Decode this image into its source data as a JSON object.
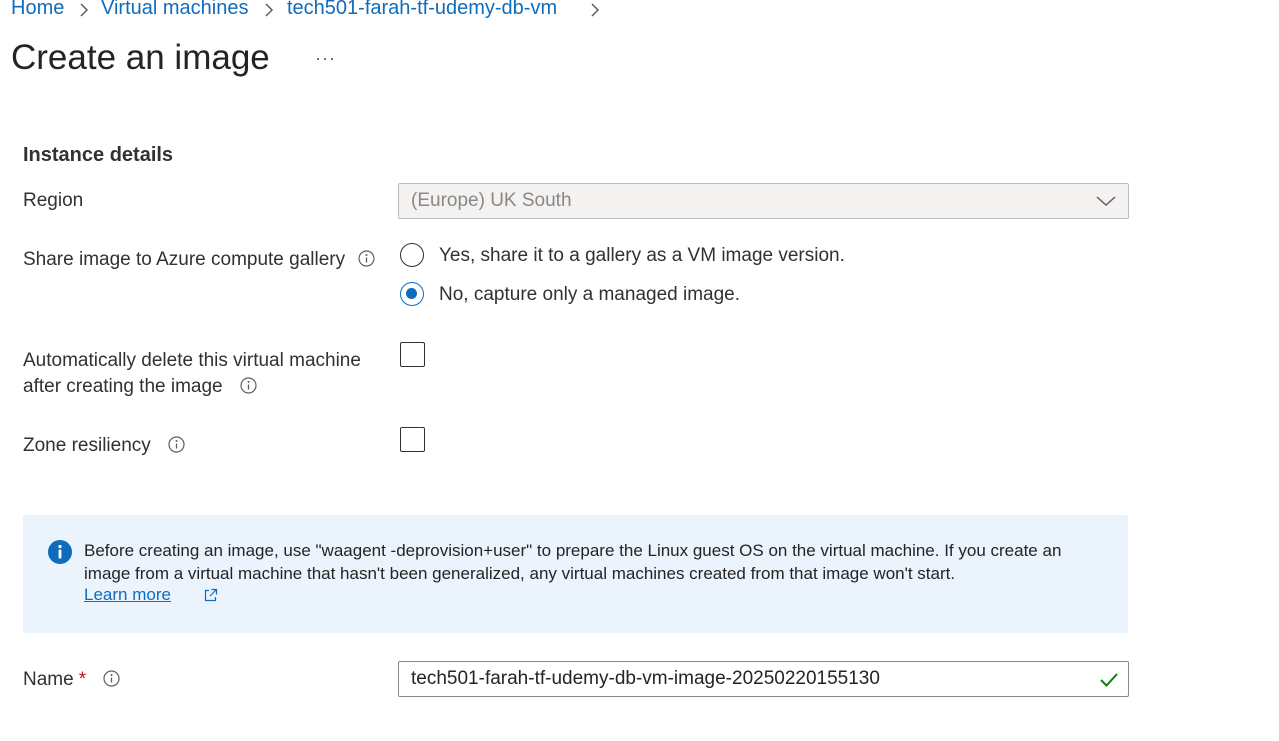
{
  "breadcrumb": {
    "items": [
      "Home",
      "Virtual machines",
      "tech501-farah-tf-udemy-db-vm"
    ]
  },
  "page": {
    "title": "Create an image",
    "more_label": "···"
  },
  "instance_details": {
    "section_title": "Instance details",
    "region": {
      "label": "Region",
      "value": "(Europe) UK South"
    },
    "share_gallery": {
      "label": "Share image to Azure compute gallery",
      "options": [
        "Yes, share it to a gallery as a VM image version.",
        "No, capture only a managed image."
      ],
      "selected": "No, capture only a managed image."
    },
    "auto_delete": {
      "label_line1": "Automatically delete this virtual machine",
      "label_line2": "after creating the image",
      "checked": false
    },
    "zone_resiliency": {
      "label": "Zone resiliency",
      "checked": false
    }
  },
  "info_box": {
    "text": "Before creating an image, use \"waagent -deprovision+user\" to prepare the Linux guest OS on the virtual machine. If you create an image from a virtual machine that hasn't been generalized, any virtual machines created from that image won't start.",
    "link_label": "Learn more"
  },
  "name_field": {
    "label": "Name",
    "required_marker": "*",
    "value": "tech501-farah-tf-udemy-db-vm-image-20250220155130",
    "valid": true
  },
  "colors": {
    "link": "#0f6cbd",
    "info_bg": "#ebf3fc",
    "valid_green": "#107c10",
    "required_red": "#c50f1f"
  }
}
